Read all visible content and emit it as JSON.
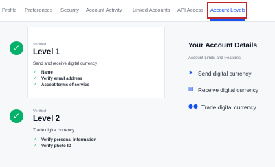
{
  "tabs": [
    {
      "label": "Profile"
    },
    {
      "label": "Preferences"
    },
    {
      "label": "Security"
    },
    {
      "label": "Account Activity"
    },
    {
      "label": "Linked Accounts"
    },
    {
      "label": "API Access"
    },
    {
      "label": "Account Levels",
      "active": true
    }
  ],
  "levels": [
    {
      "status": "Verified",
      "title": "Level 1",
      "description": "Send and receive digital currency",
      "requirements": [
        "Name",
        "Verify email address",
        "Accept terms of service"
      ]
    },
    {
      "status": "Verified",
      "title": "Level 2",
      "description": "Trade digital currency",
      "requirements": [
        "Verify personal information",
        "Verify photo ID"
      ]
    }
  ],
  "details": {
    "title": "Your Account Details",
    "subtitle": "Account Limits and Features",
    "items": [
      {
        "label": "Send digital currency",
        "icon": "send-icon"
      },
      {
        "label": "Receive digital currency",
        "icon": "receive-icon"
      },
      {
        "label": "Trade digital currency",
        "icon": "trade-icon"
      }
    ]
  },
  "colors": {
    "accent": "#1652f0",
    "success": "#05b169",
    "highlight": "#c0272d"
  }
}
